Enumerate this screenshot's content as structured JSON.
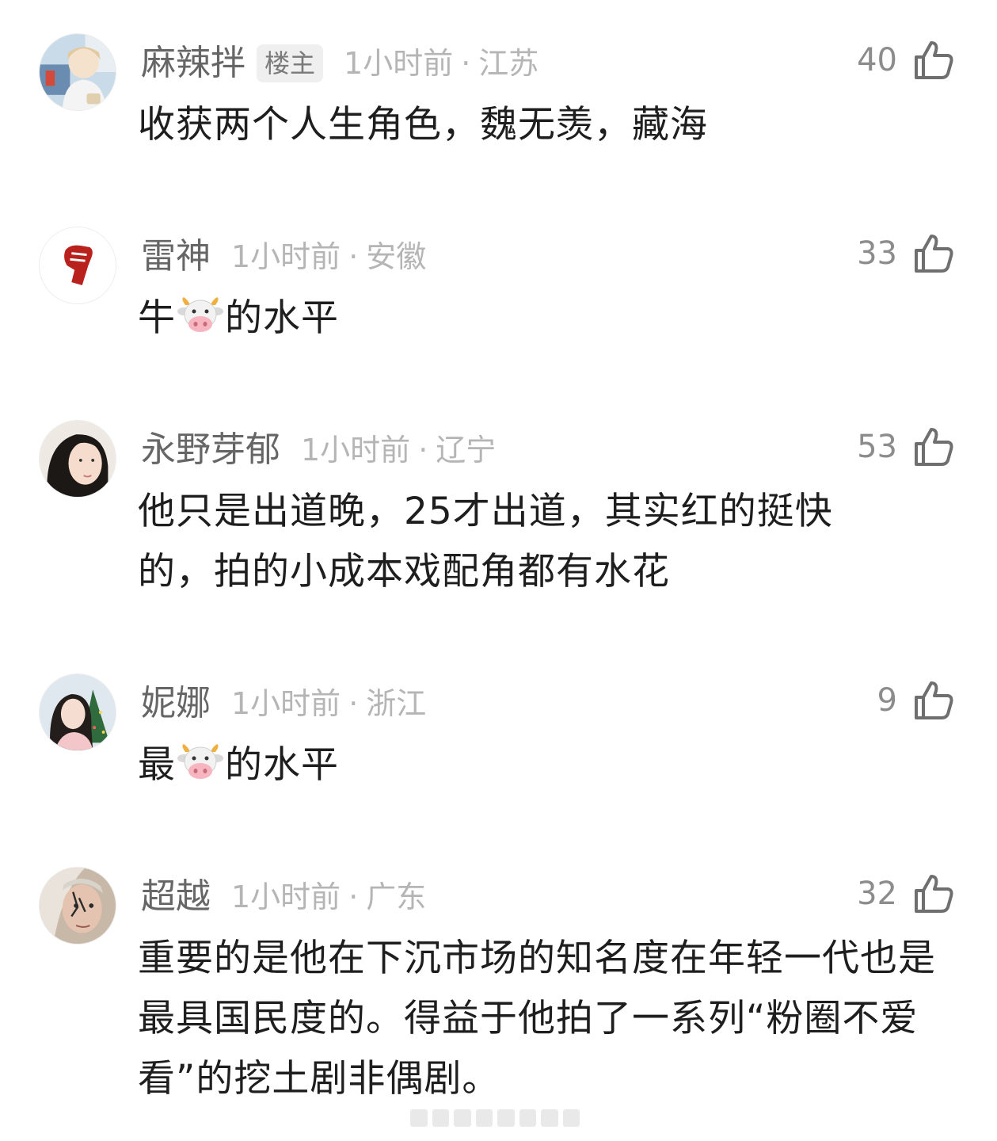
{
  "comments": [
    {
      "username": "麻辣拌",
      "badge": "楼主",
      "time": "1小时前",
      "location": "江苏",
      "likes": "40",
      "text": "收获两个人生角色，魏无羡，藏海",
      "avatar_icon": "anime-boy-avatar"
    },
    {
      "username": "雷神",
      "time": "1小时前",
      "location": "安徽",
      "likes": "33",
      "text_before": "牛",
      "emoji": "cow-face-emoji",
      "text_after": "的水平",
      "avatar_icon": "red-fist-avatar"
    },
    {
      "username": "永野芽郁",
      "time": "1小时前",
      "location": "辽宁",
      "likes": "53",
      "text": "他只是出道晚，25才出道，其实红的挺快的，拍的小成本戏配角都有水花",
      "avatar_icon": "woman-portrait-avatar"
    },
    {
      "username": "妮娜",
      "time": "1小时前",
      "location": "浙江",
      "likes": "9",
      "text_before": "最",
      "emoji": "cow-face-emoji",
      "text_after": "的水平",
      "avatar_icon": "girl-christmas-avatar"
    },
    {
      "username": "超越",
      "time": "1小时前",
      "location": "广东",
      "likes": "32",
      "text": "重要的是他在下沉市场的知名度在年轻一代也是最具国民度的。得益于他拍了一系列“粉圈不爱看”的挖土剧非偶剧。",
      "avatar_icon": "fantasy-character-avatar"
    }
  ],
  "separator": "·",
  "icons": {
    "like": "thumbs-up-icon"
  },
  "colors": {
    "username": "#666666",
    "meta": "#b5b5b5",
    "text": "#1e1e1e",
    "badge_bg": "#efefef"
  }
}
